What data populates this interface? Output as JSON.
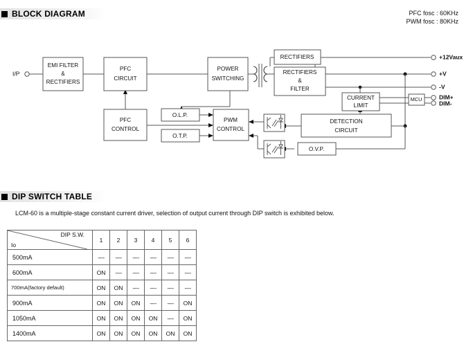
{
  "sections": {
    "block_diagram": {
      "title": "BLOCK DIAGRAM",
      "notes": {
        "pfc_fosc": "PFC fosc : 60KHz",
        "pwm_fosc": "PWM fosc : 80KHz"
      },
      "input_terminal": "I/P",
      "blocks": {
        "emi_filter": [
          "EMI FILTER",
          "&",
          "RECTIFIERS"
        ],
        "pfc_circuit": [
          "PFC",
          "CIRCUIT"
        ],
        "power_switching": [
          "POWER",
          "SWITCHING"
        ],
        "pfc_control": [
          "PFC",
          "CONTROL"
        ],
        "olp": "O.L.P.",
        "otp": "O.T.P.",
        "pwm_control": [
          "PWM",
          "CONTROL"
        ],
        "rectifiers": "RECTIFIERS",
        "rectifiers_filter": [
          "RECTIFIERS",
          "&",
          "FILTER"
        ],
        "current_limit": [
          "CURRENT",
          "LIMIT"
        ],
        "detection_circuit": [
          "DETECTION",
          "CIRCUIT"
        ],
        "ovp": "O.V.P.",
        "mcu": "MCU"
      },
      "output_terminals": [
        "+12Vaux",
        "+V",
        "-V",
        "DIM+",
        "DIM-"
      ]
    },
    "dip_switch": {
      "title": "DIP SWITCH TABLE",
      "description": "LCM-60 is a multiple-stage constant current driver, selection of output current through DIP switch is exhibited below.",
      "table": {
        "corner_top_right": "DIP S.W.",
        "corner_bottom_left": "Io",
        "columns": [
          "1",
          "2",
          "3",
          "4",
          "5",
          "6"
        ],
        "rows": [
          {
            "label": "500mA",
            "values": [
              "----",
              "----",
              "----",
              "----",
              "----",
              "----"
            ]
          },
          {
            "label": "600mA",
            "values": [
              "ON",
              "----",
              "----",
              "----",
              "----",
              "----"
            ]
          },
          {
            "label": "700mA(factory default)",
            "values": [
              "ON",
              "ON",
              "----",
              "----",
              "----",
              "----"
            ]
          },
          {
            "label": "900mA",
            "values": [
              "ON",
              "ON",
              "ON",
              "----",
              "----",
              "ON"
            ]
          },
          {
            "label": "1050mA",
            "values": [
              "ON",
              "ON",
              "ON",
              "ON",
              "----",
              "ON"
            ]
          },
          {
            "label": "1400mA",
            "values": [
              "ON",
              "ON",
              "ON",
              "ON",
              "ON",
              "ON"
            ]
          }
        ]
      }
    }
  }
}
